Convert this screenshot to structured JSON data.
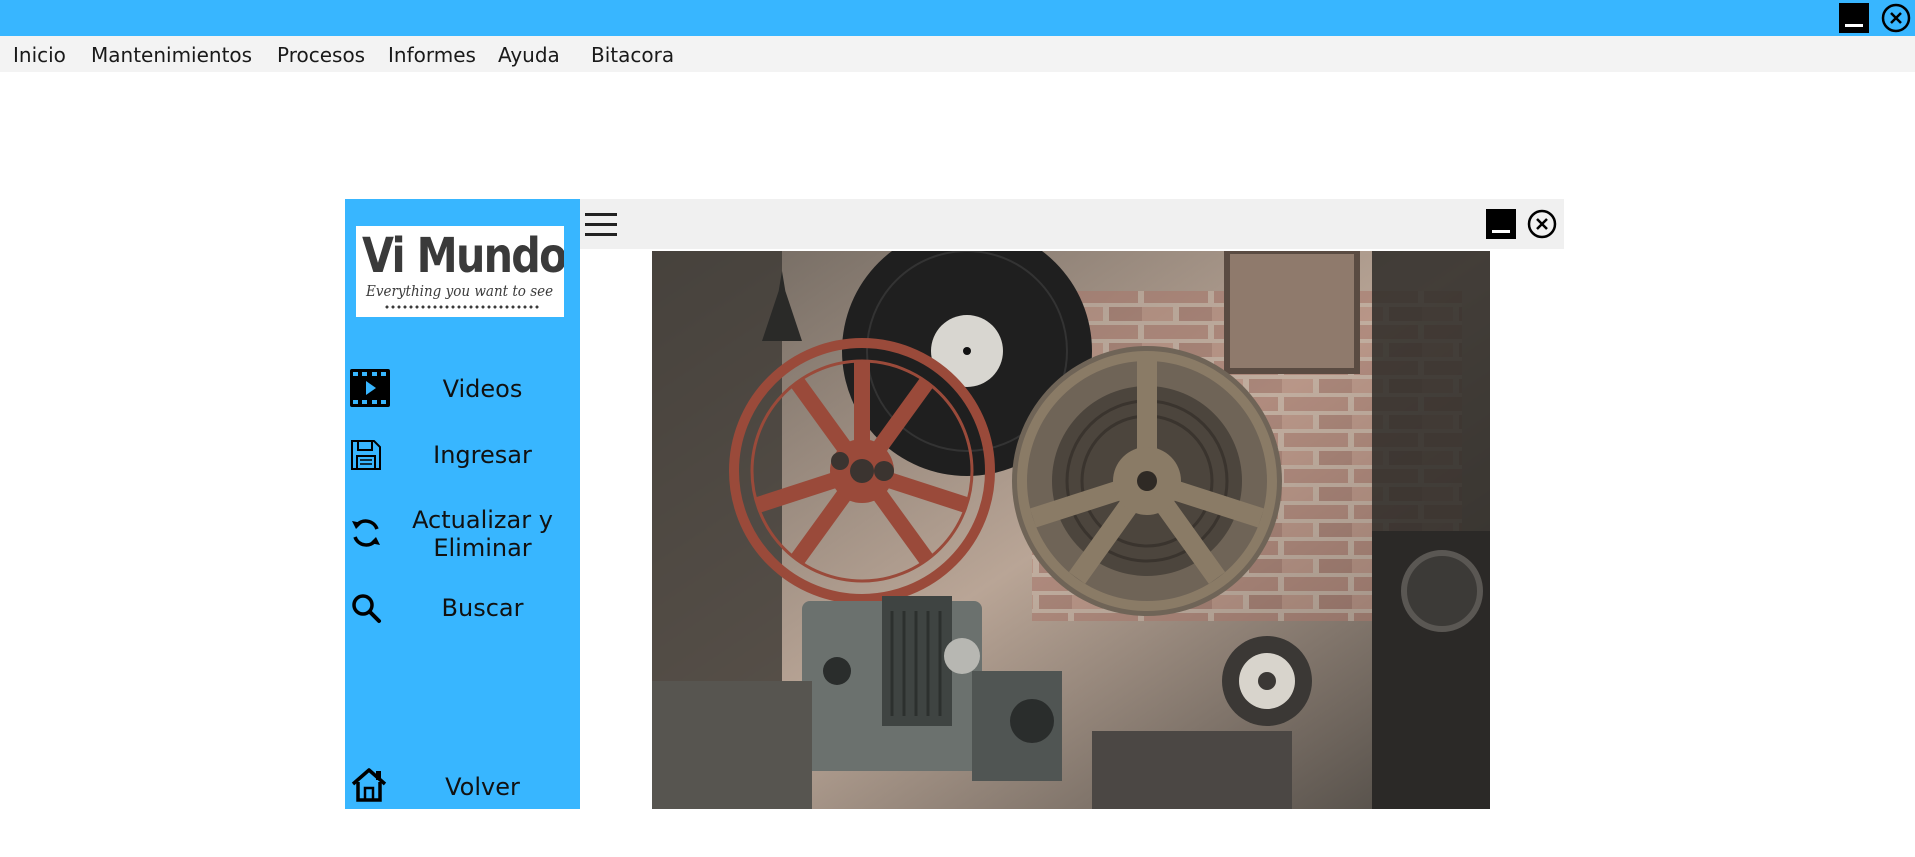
{
  "window": {
    "titlebar_color": "#38b6ff",
    "controls": [
      {
        "icon": "minimize-icon"
      },
      {
        "icon": "close-icon"
      }
    ]
  },
  "menu": {
    "items": [
      {
        "label": "Inicio"
      },
      {
        "label": "Mantenimientos"
      },
      {
        "label": "Procesos"
      },
      {
        "label": "Informes"
      },
      {
        "label": "Ayuda"
      },
      {
        "label": "Bitacora"
      }
    ]
  },
  "sidebar": {
    "color": "#38b6ff",
    "logo": {
      "title": "Vi Mundo",
      "tagline": "Everything you want to see"
    },
    "items": [
      {
        "label": "Videos",
        "icon": "film-icon"
      },
      {
        "label": "Ingresar",
        "icon": "save-icon"
      },
      {
        "label": "Actualizar y Eliminar",
        "icon": "refresh-icon"
      },
      {
        "label": "Buscar",
        "icon": "search-icon"
      },
      {
        "label": "Volver",
        "icon": "home-icon"
      }
    ]
  },
  "inner_window": {
    "menu_icon": "hamburger-icon",
    "controls": [
      {
        "icon": "minimize-icon"
      },
      {
        "icon": "close-icon"
      }
    ]
  },
  "hero_image": {
    "subject": "vintage film projectors and reels"
  }
}
